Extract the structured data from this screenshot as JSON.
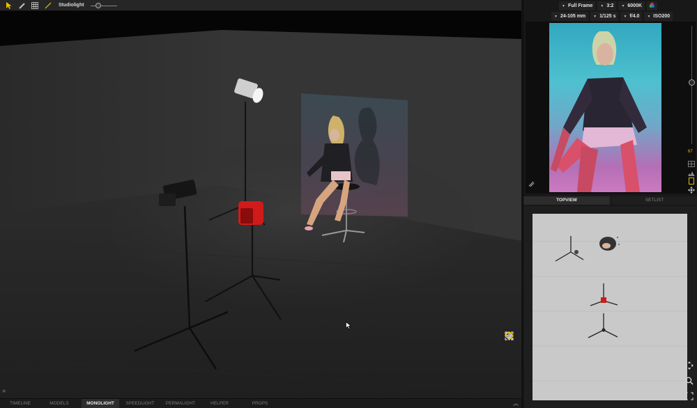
{
  "toolbar": {
    "tools": [
      {
        "icon": "pointer-arrow-icon",
        "active": true
      },
      {
        "icon": "ruler-icon",
        "active": false
      },
      {
        "icon": "grid-icon",
        "active": false
      },
      {
        "icon": "line-tool-icon",
        "active": false
      }
    ],
    "studiolight_label": "Studiolight",
    "studiolight_level": 0.25
  },
  "camera": {
    "sensor": "Full Frame",
    "aspect": "3:2",
    "white_balance": "6000K",
    "lens": "24-105 mm",
    "shutter": "1/125 s",
    "aperture": "f/4.0",
    "iso": "ISO200",
    "color_icon": "color-wheel-icon"
  },
  "preview": {
    "focal_readout": "67",
    "zoom_level": 0.45
  },
  "panel_tabs": [
    {
      "label": "TOPVIEW",
      "active": true
    },
    {
      "label": "SETLIST",
      "active": false
    }
  ],
  "bottom_tabs": [
    {
      "label": "TIMELINE",
      "active": false
    },
    {
      "label": "MODELS",
      "active": false
    },
    {
      "label": "MONOLIGHT",
      "active": true
    },
    {
      "label": "SPEEDLIGHT",
      "active": false
    },
    {
      "label": "PERMALIGHT",
      "active": false
    },
    {
      "label": "HELPER",
      "active": false
    },
    {
      "label": "PROPS",
      "active": false
    }
  ],
  "viewport_tools": [
    "orbit-icon",
    "pan-icon",
    "zoom-icon",
    "fit-frame-icon",
    "reset-view-icon"
  ],
  "colors": {
    "accent": "#e8c200",
    "monolight_red": "#d11a1a",
    "panel_bg": "#181818"
  }
}
